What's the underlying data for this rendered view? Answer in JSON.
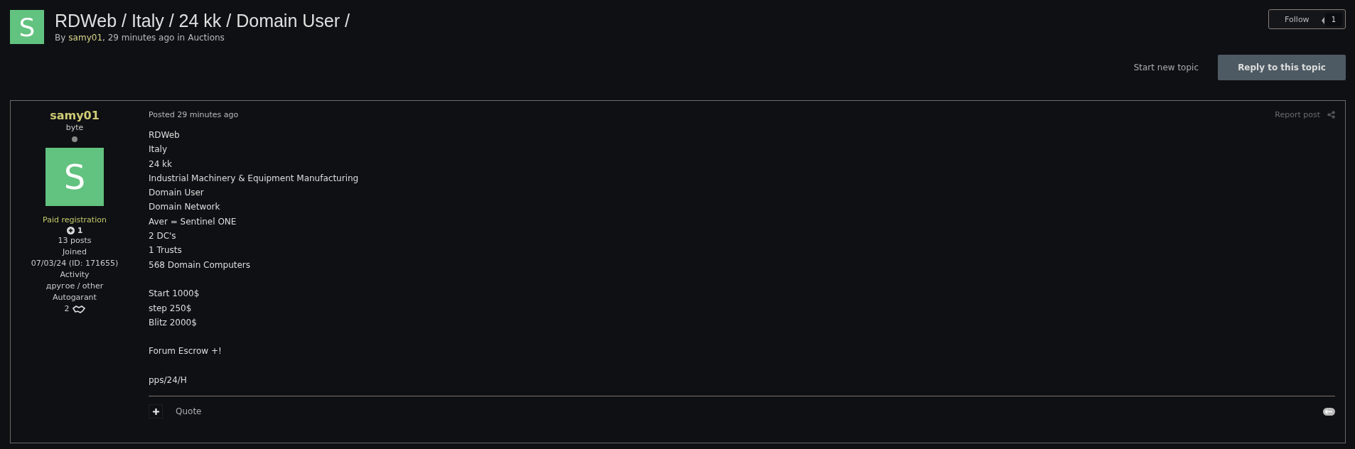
{
  "topic": {
    "avatar_letter": "S",
    "title": "RDWeb / Italy / 24 kk / Domain User /",
    "by": "By",
    "author": "samy01",
    "meta": ", 29 minutes ago in",
    "forum": "Auctions"
  },
  "follow": {
    "label": "Follow",
    "count": "1"
  },
  "actions": {
    "start": "Start new topic",
    "reply": "Reply to this topic"
  },
  "post": {
    "author": {
      "name": "samy01",
      "rank": "byte",
      "online": false,
      "avatar_letter": "S",
      "group": "Paid registration",
      "reputation": "1",
      "posts": "13 posts",
      "joined_label": "Joined",
      "joined": "07/03/24 (ID: 171655)",
      "activity_label": "Activity",
      "activity": "другое / other",
      "autogarant_label": "Autogarant",
      "autogarant": "2"
    },
    "posted": "Posted 29 minutes ago",
    "report": "Report post",
    "paragraphs": [
      [
        "RDWeb",
        "Italy",
        "24 kk",
        "Industrial Machinery & Equipment Manufacturing",
        "Domain User",
        "Domain Network",
        "Aver = Sentinel ONE",
        "2 DC's",
        "1 Trusts",
        "568 Domain Computers"
      ],
      [
        "Start 1000$",
        "step 250$",
        "Blitz 2000$"
      ],
      [
        "Forum Escrow +!"
      ],
      [
        "pps/24/H"
      ]
    ],
    "quote": "Quote"
  }
}
